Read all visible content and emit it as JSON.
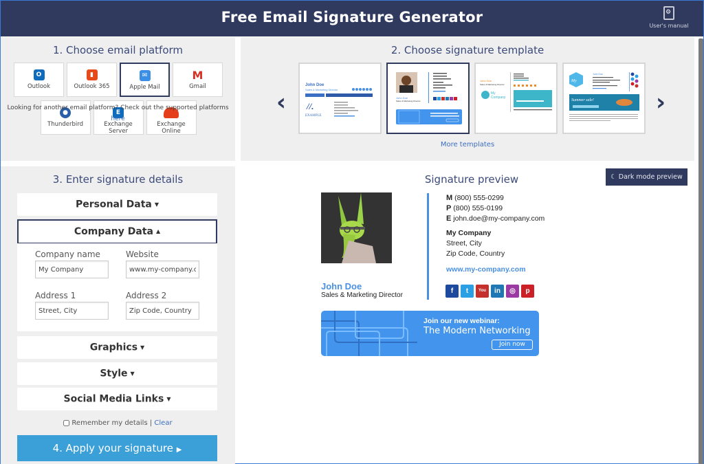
{
  "header": {
    "title": "Free Email Signature Generator",
    "manual_label": "User's manual"
  },
  "step1": {
    "title": "1. Choose email platform",
    "platforms": [
      {
        "label": "Outlook",
        "icon": "outlook-icon",
        "color": "#0f6cbd",
        "selected": false
      },
      {
        "label": "Outlook 365",
        "icon": "office365-icon",
        "color": "#e64a19",
        "selected": false
      },
      {
        "label": "Apple Mail",
        "icon": "apple-mail-icon",
        "color": "#3a8ee6",
        "selected": true
      },
      {
        "label": "Gmail",
        "icon": "gmail-icon",
        "color": "#d93025",
        "selected": false
      },
      {
        "label": "Thunderbird",
        "icon": "thunderbird-icon",
        "color": "#2a5ea8",
        "selected": false
      },
      {
        "label": "Exchange Server",
        "icon": "exchange-server-icon",
        "color": "#0f6cbd",
        "selected": false
      },
      {
        "label": "Exchange Online",
        "icon": "exchange-online-icon",
        "color": "#e53e1a",
        "selected": false
      }
    ],
    "note": "Looking for another email platform? Check out the supported platforms",
    "note_link": "here"
  },
  "step2": {
    "title": "2. Choose signature template",
    "more_templates": "More templates",
    "templates": [
      {
        "name": "John Doe",
        "subtitle": "Sales & Marketing Director",
        "selected": false
      },
      {
        "name": "John Doe",
        "subtitle": "Sales & Marketing Director",
        "selected": true
      },
      {
        "name": "John Doe",
        "subtitle": "Sales & Marketing Director",
        "selected": false
      },
      {
        "name": "John Doe",
        "subtitle": "Sales & Marketing Director",
        "selected": false
      }
    ]
  },
  "step3": {
    "title": "3. Enter signature details",
    "sections": {
      "personal": "Personal Data",
      "company": "Company Data",
      "graphics": "Graphics",
      "style": "Style",
      "social": "Social Media Links"
    },
    "company_fields": {
      "company_name_label": "Company name",
      "company_name_value": "My Company",
      "website_label": "Website",
      "website_value": "www.my-company.com",
      "address1_label": "Address 1",
      "address1_value": "Street, City",
      "address2_label": "Address 2",
      "address2_value": "Zip Code, Country"
    },
    "remember_label": "Remember my details",
    "separator": "|",
    "clear_label": "Clear",
    "apply_label": "4. Apply your signature"
  },
  "preview": {
    "title": "Signature preview",
    "dark_mode_label": "Dark mode preview",
    "name": "John Doe",
    "role": "Sales & Marketing Director",
    "mobile_prefix": "M",
    "mobile": "(800) 555-0299",
    "phone_prefix": "P",
    "phone": "(800) 555-0199",
    "email_prefix": "E",
    "email": "john.doe@my-company.com",
    "company": "My Company",
    "address1": "Street, City",
    "address2": "Zip Code, Country",
    "website": "www.my-company.com",
    "socials": [
      {
        "name": "facebook",
        "glyph": "f",
        "color": "#1d4a9c"
      },
      {
        "name": "twitter",
        "glyph": "t",
        "color": "#2b9fe3"
      },
      {
        "name": "youtube",
        "glyph": "You",
        "color": "#c4302b"
      },
      {
        "name": "linkedin",
        "glyph": "in",
        "color": "#1f78b4"
      },
      {
        "name": "instagram",
        "glyph": "◎",
        "color": "#9b3aa5"
      },
      {
        "name": "pinterest",
        "glyph": "p",
        "color": "#cb2027"
      }
    ],
    "banner": {
      "line1": "Join our new webinar:",
      "line2": "The Modern Networking",
      "cta": "Join now"
    }
  }
}
